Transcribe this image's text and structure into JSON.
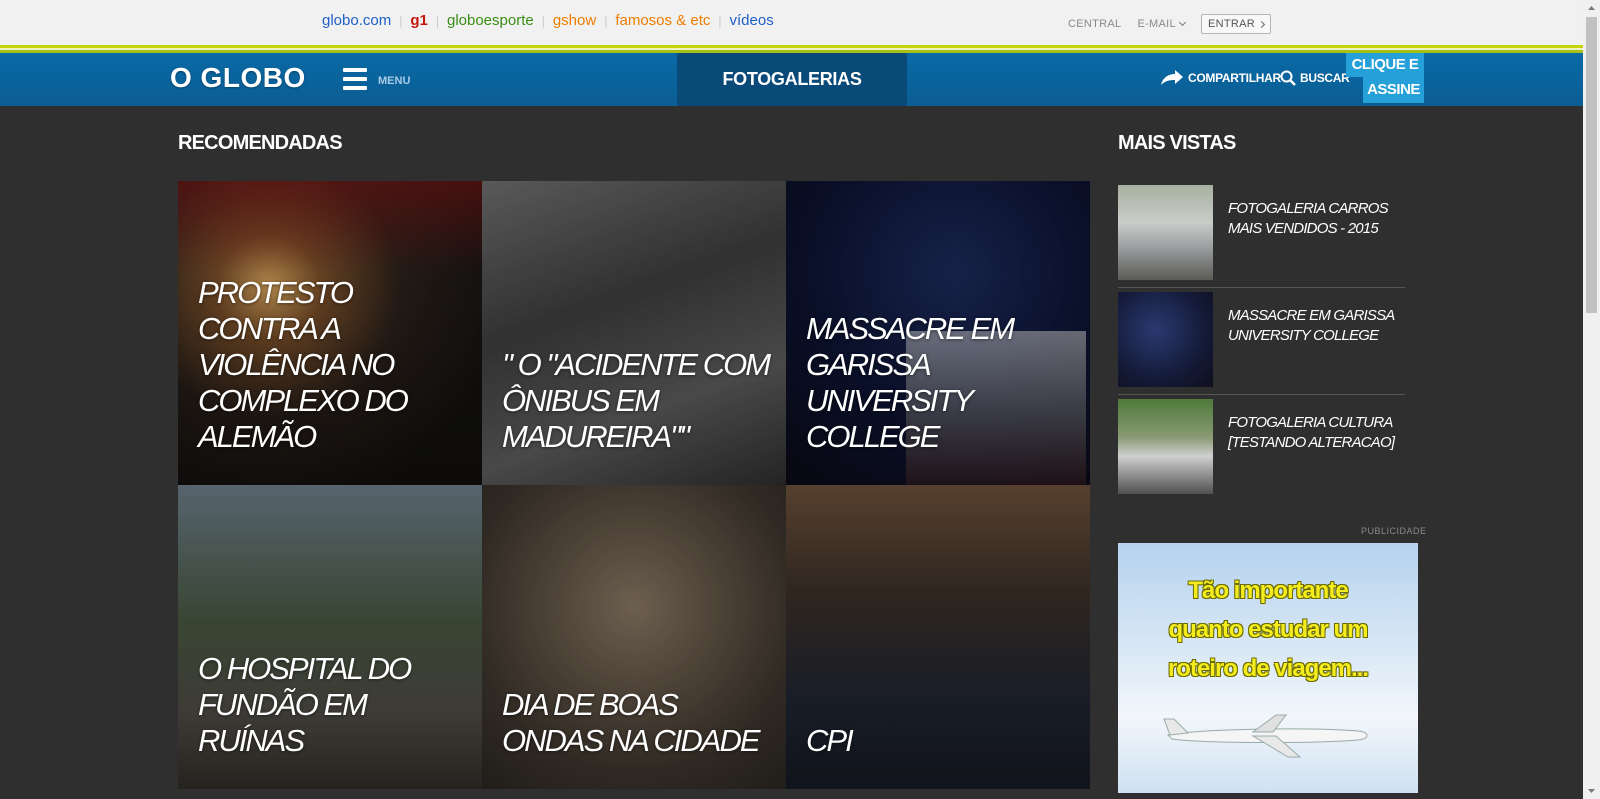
{
  "globobar": {
    "links": [
      {
        "label": "globo.com",
        "color": "#1f5fc8"
      },
      {
        "label": "g1",
        "color": "#c4170c"
      },
      {
        "label": "globoesporte",
        "color": "#3a8e16"
      },
      {
        "label": "gshow",
        "color": "#f07c00"
      },
      {
        "label": "famosos & etc",
        "color": "#f07c00"
      },
      {
        "label": "vídeos",
        "color": "#1f5fc8"
      }
    ],
    "central": "CENTRAL",
    "email": "E-MAIL",
    "entrar": "ENTRAR"
  },
  "header": {
    "logo": "O GLOBO",
    "menu_label": "MENU",
    "section": "FOTOGALERIAS",
    "share_label": "COMPARTILHAR",
    "search_label": "BUSCAR",
    "assine_line1": "CLIQUE E",
    "assine_line2": "ASSINE"
  },
  "recomendadas": {
    "title": "RECOMENDADAS",
    "items": [
      {
        "caption": "PROTESTO CONTRA A VIOLÊNCIA NO COMPLEXO DO ALEMÃO"
      },
      {
        "caption": "\" O \"ACIDENTE COM ÔNIBUS EM MADUREIRA\"\""
      },
      {
        "caption": "MASSACRE EM GARISSA UNIVERSITY COLLEGE"
      },
      {
        "caption": "O HOSPITAL DO FUNDÃO EM RUÍNAS"
      },
      {
        "caption": "DIA DE BOAS ONDAS NA CIDADE"
      },
      {
        "caption": "CPI"
      }
    ]
  },
  "mais_vistas": {
    "title": "MAIS VISTAS",
    "items": [
      {
        "title": "FOTOGALERIA CARROS MAIS VENDIDOS - 2015"
      },
      {
        "title": "MASSACRE EM GARISSA UNIVERSITY COLLEGE"
      },
      {
        "title": "FOTOGALERIA CULTURA [TESTANDO ALTERACAO]"
      }
    ]
  },
  "publicidade": {
    "label": "PUBLICIDADE",
    "ad_line1": "Tão importante",
    "ad_line2": "quanto estudar um",
    "ad_line3": "roteiro de viagem..."
  },
  "colors": {
    "header_blue": "#0a6aa6",
    "section_tab": "#094a78",
    "assine": "#26a0d8",
    "background": "#2f2f2f",
    "stripe_yellow": "#c8d400"
  }
}
